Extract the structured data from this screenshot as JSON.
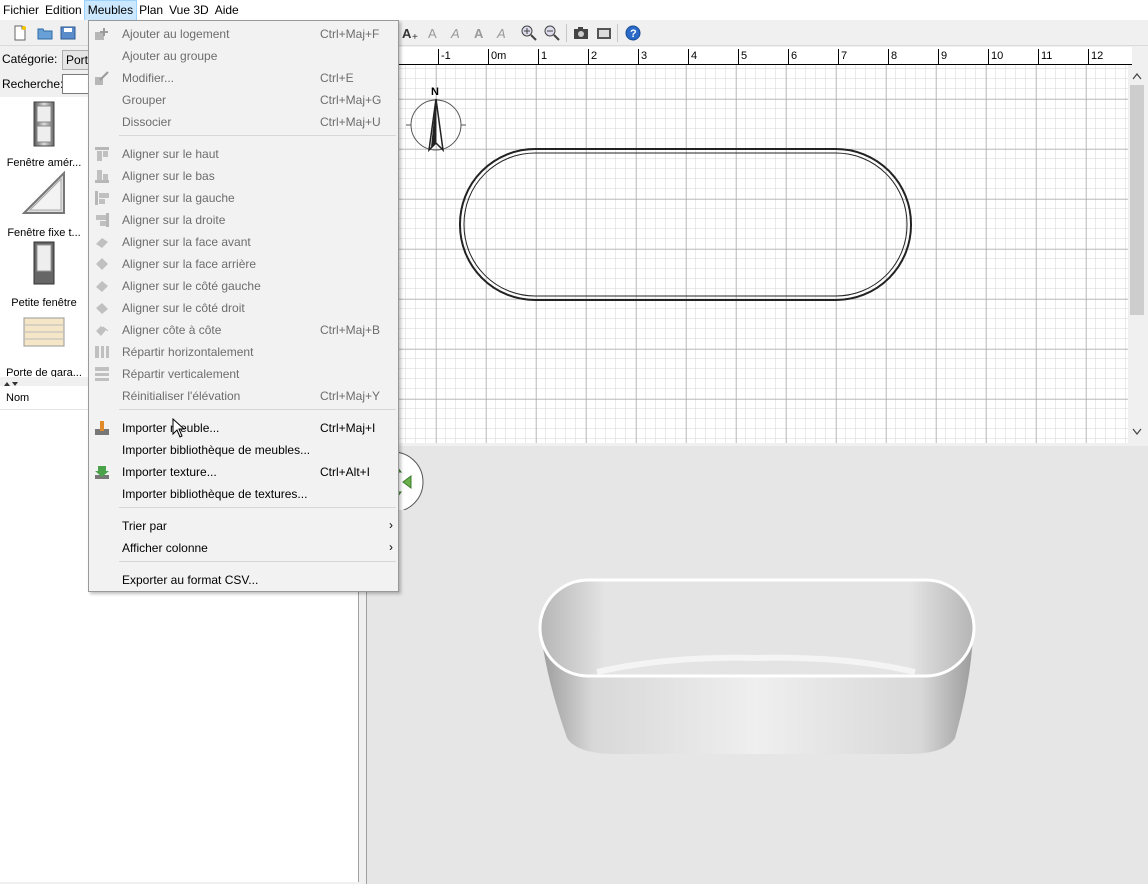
{
  "menubar": {
    "items": [
      "Fichier",
      "Edition",
      "Meubles",
      "Plan",
      "Vue 3D",
      "Aide"
    ],
    "active": "Meubles"
  },
  "left": {
    "category_label": "Catégorie:",
    "category_value": "Porte",
    "search_label": "Recherche:",
    "catalog_items": [
      "Fenêtre amér...",
      "Fenêtre fixe t...",
      "Petite fenêtre",
      "Porte de gara..."
    ],
    "table_header": "Nom"
  },
  "plan": {
    "ruler_labels": [
      "-1",
      "0m",
      "1",
      "2",
      "3",
      "4",
      "5",
      "6",
      "7",
      "8",
      "9",
      "10",
      "11",
      "12"
    ],
    "compass_label": "N"
  },
  "menu": {
    "items": [
      {
        "label": "Ajouter au logement",
        "shortcut": "Ctrl+Maj+F",
        "enabled": false,
        "icon": "add-furniture-icon"
      },
      {
        "label": "Ajouter au groupe",
        "shortcut": "",
        "enabled": false,
        "icon": ""
      },
      {
        "label": "Modifier...",
        "shortcut": "Ctrl+E",
        "enabled": false,
        "icon": "modify-furniture-icon"
      },
      {
        "label": "Grouper",
        "shortcut": "Ctrl+Maj+G",
        "enabled": false,
        "icon": ""
      },
      {
        "label": "Dissocier",
        "shortcut": "Ctrl+Maj+U",
        "enabled": false,
        "icon": ""
      },
      {
        "label": "Aligner sur le haut",
        "shortcut": "",
        "enabled": false,
        "icon": "align-top-icon"
      },
      {
        "label": "Aligner sur le bas",
        "shortcut": "",
        "enabled": false,
        "icon": "align-bottom-icon"
      },
      {
        "label": "Aligner sur la gauche",
        "shortcut": "",
        "enabled": false,
        "icon": "align-left-icon"
      },
      {
        "label": "Aligner sur la droite",
        "shortcut": "",
        "enabled": false,
        "icon": "align-right-icon"
      },
      {
        "label": "Aligner sur la face avant",
        "shortcut": "",
        "enabled": false,
        "icon": "align-front-icon"
      },
      {
        "label": "Aligner sur la face arrière",
        "shortcut": "",
        "enabled": false,
        "icon": "align-back-icon"
      },
      {
        "label": "Aligner sur le côté gauche",
        "shortcut": "",
        "enabled": false,
        "icon": "align-left-side-icon"
      },
      {
        "label": "Aligner sur le côté droit",
        "shortcut": "",
        "enabled": false,
        "icon": "align-right-side-icon"
      },
      {
        "label": "Aligner côte à côte",
        "shortcut": "Ctrl+Maj+B",
        "enabled": false,
        "icon": "align-side-by-side-icon"
      },
      {
        "label": "Répartir horizontalement",
        "shortcut": "",
        "enabled": false,
        "icon": "distribute-horizontal-icon"
      },
      {
        "label": "Répartir verticalement",
        "shortcut": "",
        "enabled": false,
        "icon": "distribute-vertical-icon"
      },
      {
        "label": "Réinitialiser l'élévation",
        "shortcut": "Ctrl+Maj+Y",
        "enabled": false,
        "icon": ""
      },
      {
        "label": "Importer meuble...",
        "shortcut": "Ctrl+Maj+I",
        "enabled": true,
        "icon": "import-furniture-icon"
      },
      {
        "label": "Importer bibliothèque de meubles...",
        "shortcut": "",
        "enabled": true,
        "icon": ""
      },
      {
        "label": "Importer texture...",
        "shortcut": "Ctrl+Alt+I",
        "enabled": true,
        "icon": "import-texture-icon"
      },
      {
        "label": "Importer bibliothèque de textures...",
        "shortcut": "",
        "enabled": true,
        "icon": ""
      },
      {
        "label": "Trier par",
        "shortcut": "",
        "enabled": true,
        "icon": "",
        "submenu": true
      },
      {
        "label": "Afficher colonne",
        "shortcut": "",
        "enabled": true,
        "icon": "",
        "submenu": true
      },
      {
        "label": "Exporter au format CSV...",
        "shortcut": "",
        "enabled": true,
        "icon": ""
      }
    ]
  },
  "colors": {
    "menu_bg": "#f2f2f2",
    "active_menu_bg": "#cce8ff",
    "disabled_text": "#6d6d6d",
    "plan_grid": "#c8c8c8",
    "view3d_bg": "#e6e6e6"
  }
}
